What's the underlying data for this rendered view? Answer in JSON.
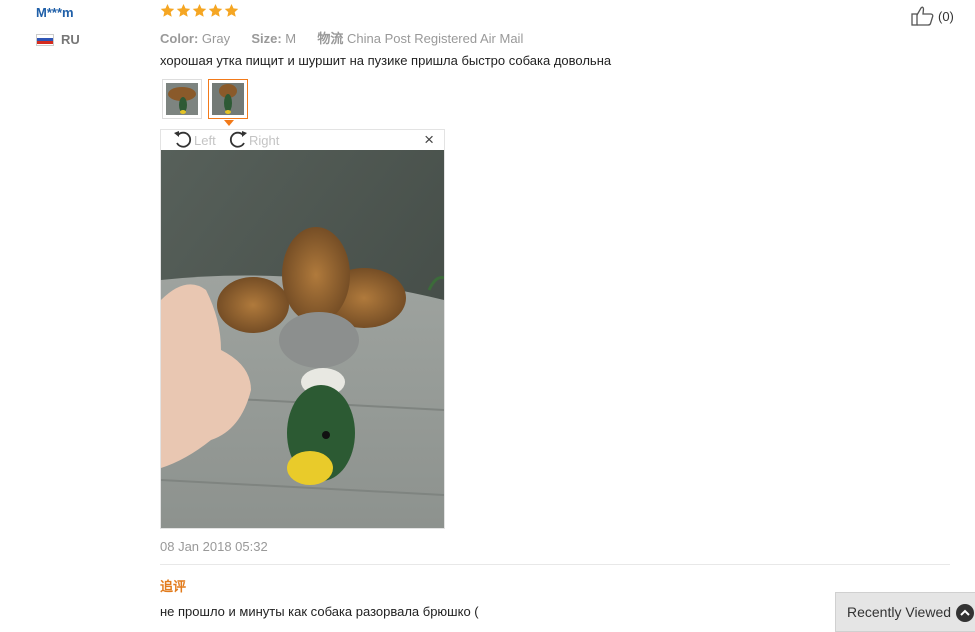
{
  "user": {
    "name": "M***m",
    "country_code": "RU",
    "flag_icon": "russia-flag-icon"
  },
  "review": {
    "rating": 5,
    "star_color": "#f5a623",
    "attributes": [
      {
        "label": "Color:",
        "value": "Gray"
      },
      {
        "label": "Size:",
        "value": "M"
      },
      {
        "label": "物流",
        "value": "China Post Registered Air Mail"
      }
    ],
    "text": "хорошая утка пищит и шуршит на пузике пришла быстро собака довольна",
    "date": "08 Jan 2018 05:32",
    "likes": "(0)",
    "thumbnails": [
      {
        "name": "thumbnail-1",
        "selected": false
      },
      {
        "name": "thumbnail-2",
        "selected": true
      }
    ]
  },
  "viewer": {
    "rotate_left_label": "Left",
    "rotate_right_label": "Right",
    "close_label": "×"
  },
  "followup": {
    "label": "追评",
    "text": "не прошло и минуты как собака разорвала брюшко ("
  },
  "recently_viewed": {
    "label": "Recently Viewed"
  },
  "accent_color": "#f27a1a",
  "link_color": "#1f5fa8"
}
